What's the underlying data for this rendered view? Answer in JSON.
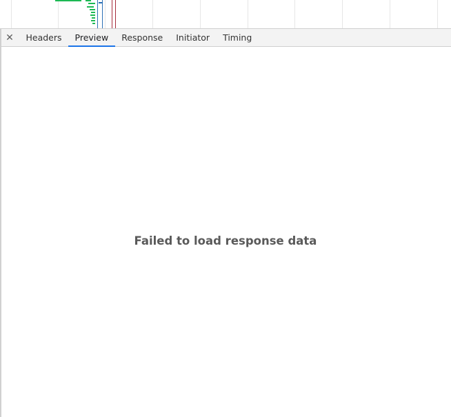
{
  "tabs": [
    {
      "label": "Headers",
      "active": false
    },
    {
      "label": "Preview",
      "active": true
    },
    {
      "label": "Response",
      "active": false
    },
    {
      "label": "Initiator",
      "active": false
    },
    {
      "label": "Timing",
      "active": false
    }
  ],
  "close_icon": "close-icon",
  "preview": {
    "message": "Failed to load response data"
  },
  "colors": {
    "accent": "#1a73e8",
    "waterfall_green": "#1db954",
    "waterfall_blue": "#2a6fb5",
    "waterfall_red": "#a52a3a"
  }
}
